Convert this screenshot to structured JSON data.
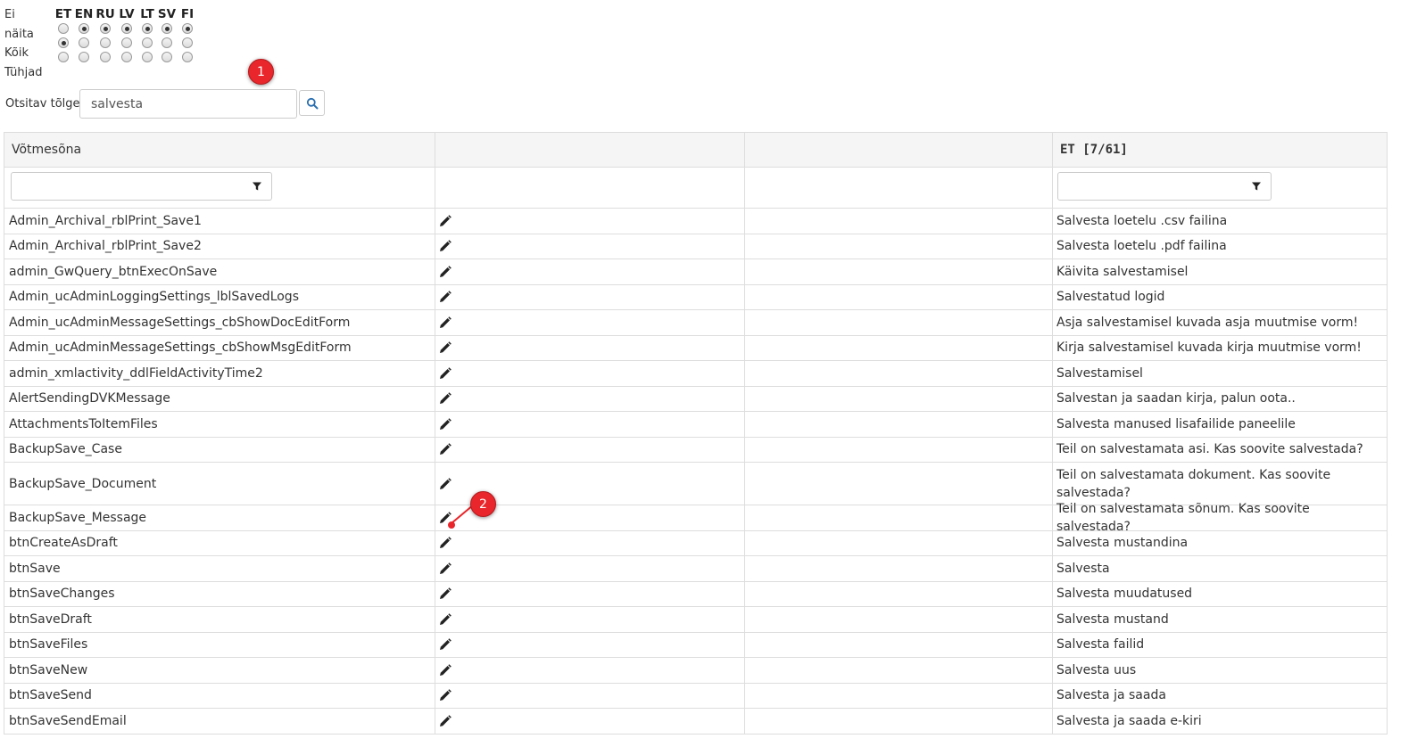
{
  "filter": {
    "labels": [
      "Ei",
      "näita",
      "Kõik",
      "Tühjad"
    ],
    "languages": [
      "ET",
      "EN",
      "RU",
      "LV",
      "LT",
      "SV",
      "FI"
    ],
    "rows": [
      {
        "name": "ei-naita",
        "selected": [
          false,
          true,
          true,
          true,
          true,
          true,
          true
        ]
      },
      {
        "name": "koik",
        "selected": [
          true,
          false,
          false,
          false,
          false,
          false,
          false
        ]
      },
      {
        "name": "tuhjad",
        "selected": [
          false,
          false,
          false,
          false,
          false,
          false,
          false
        ]
      }
    ]
  },
  "search": {
    "label": "Otsitav tõlge",
    "value": "salvesta"
  },
  "callouts": [
    "1",
    "2"
  ],
  "grid": {
    "columns": {
      "keyword": "Võtmesõna",
      "edit": "",
      "empty": "",
      "et": "ET [7/61]"
    },
    "rows": [
      {
        "key": "Admin_Archival_rblPrint_Save1",
        "et": "Salvesta loetelu .csv failina"
      },
      {
        "key": "Admin_Archival_rblPrint_Save2",
        "et": "Salvesta loetelu .pdf failina"
      },
      {
        "key": "admin_GwQuery_btnExecOnSave",
        "et": "Käivita salvestamisel"
      },
      {
        "key": "Admin_ucAdminLoggingSettings_lblSavedLogs",
        "et": "Salvestatud logid"
      },
      {
        "key": "Admin_ucAdminMessageSettings_cbShowDocEditForm",
        "et": "Asja salvestamisel kuvada asja muutmise vorm!"
      },
      {
        "key": "Admin_ucAdminMessageSettings_cbShowMsgEditForm",
        "et": "Kirja salvestamisel kuvada kirja muutmise vorm!"
      },
      {
        "key": "admin_xmlactivity_ddlFieldActivityTime2",
        "et": "Salvestamisel"
      },
      {
        "key": "AlertSendingDVKMessage",
        "et": "Salvestan ja saadan kirja, palun oota.."
      },
      {
        "key": "AttachmentsToItemFiles",
        "et": "Salvesta manused lisafailide paneelile"
      },
      {
        "key": "BackupSave_Case",
        "et": "Teil on salvestamata asi. Kas soovite salvestada?"
      },
      {
        "key": "BackupSave_Document",
        "et": "Teil on salvestamata dokument. Kas soovite salvestada?"
      },
      {
        "key": "BackupSave_Message",
        "et": "Teil on salvestamata sõnum. Kas soovite salvestada?"
      },
      {
        "key": "btnCreateAsDraft",
        "et": "Salvesta mustandina"
      },
      {
        "key": "btnSave",
        "et": "Salvesta"
      },
      {
        "key": "btnSaveChanges",
        "et": "Salvesta muudatused"
      },
      {
        "key": "btnSaveDraft",
        "et": "Salvesta mustand"
      },
      {
        "key": "btnSaveFiles",
        "et": "Salvesta failid"
      },
      {
        "key": "btnSaveNew",
        "et": "Salvesta uus"
      },
      {
        "key": "btnSaveSend",
        "et": "Salvesta ja saada"
      },
      {
        "key": "btnSaveSendEmail",
        "et": "Salvesta ja saada e-kiri"
      }
    ]
  }
}
